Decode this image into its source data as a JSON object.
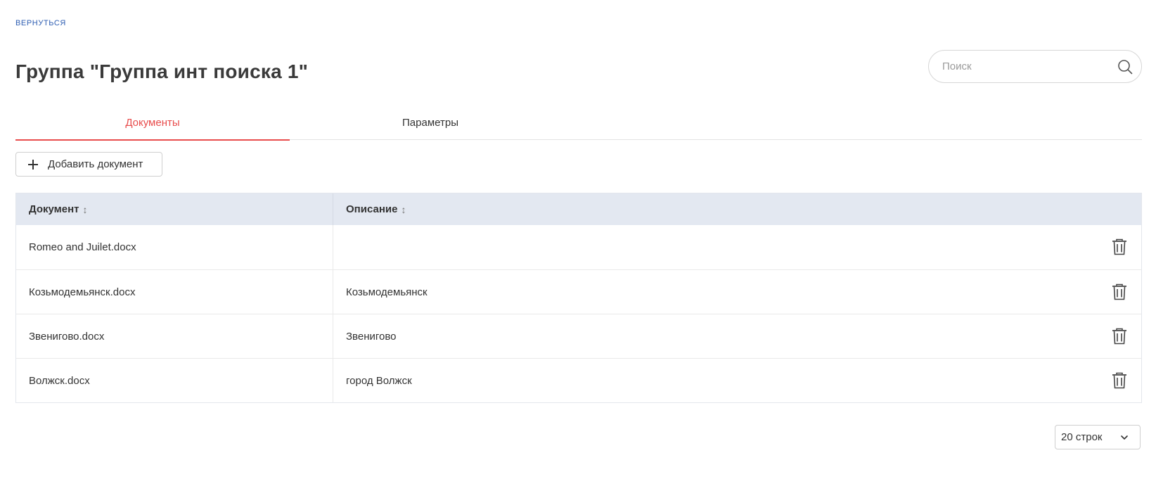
{
  "nav": {
    "back_label": "ВЕРНУТЬСЯ"
  },
  "header": {
    "title": "Группа \"Группа инт поиска 1\""
  },
  "search": {
    "placeholder": "Поиск",
    "value": ""
  },
  "tabs": [
    {
      "label": "Документы",
      "active": true
    },
    {
      "label": "Параметры",
      "active": false
    }
  ],
  "toolbar": {
    "add_label": "Добавить документ"
  },
  "table": {
    "columns": [
      {
        "label": "Документ",
        "sort_icon": "sort-icon"
      },
      {
        "label": "Описание",
        "sort_icon": "sort-icon"
      }
    ],
    "rows": [
      {
        "document": "Romeo and Juilet.docx",
        "description": ""
      },
      {
        "document": "Козьмодемьянск.docx",
        "description": "Козьмодемьянск"
      },
      {
        "document": "Звенигово.docx",
        "description": "Звенигово"
      },
      {
        "document": "Волжск.docx",
        "description": "город Волжск"
      }
    ]
  },
  "pagination": {
    "rows_per_page": "20 строк"
  },
  "colors": {
    "accent": "#e84c4c",
    "link": "#2f5fb3",
    "table_header_bg": "#e3e8f1"
  },
  "icons": [
    "search-icon",
    "plus-icon",
    "sort-icon",
    "trash-icon",
    "chevron-down-icon"
  ]
}
